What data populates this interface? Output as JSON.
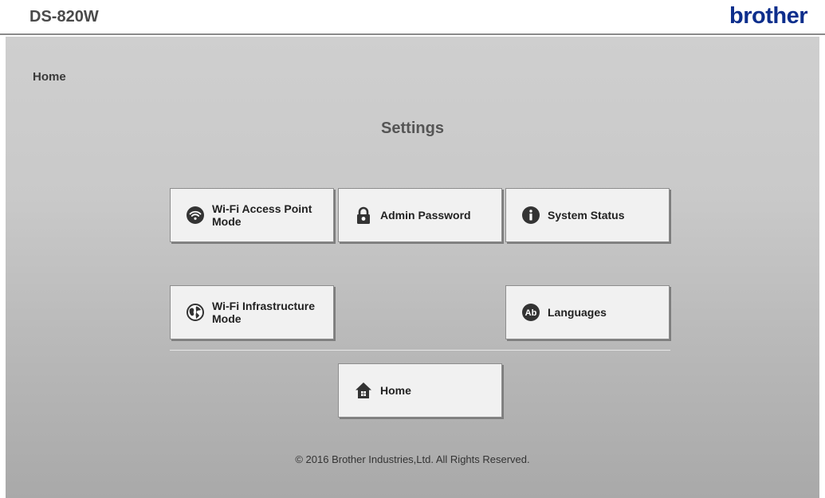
{
  "header": {
    "model": "DS-820W",
    "brand": "brother"
  },
  "breadcrumb": "Home",
  "page_title": "Settings",
  "buttons": {
    "wifi_ap": {
      "line1": "Wi-Fi Access Point",
      "line2": "Mode",
      "icon": "wifi-icon"
    },
    "admin_password": {
      "label": "Admin Password",
      "icon": "lock-icon"
    },
    "system_status": {
      "label": "System Status",
      "icon": "info-icon"
    },
    "wifi_infra": {
      "line1": "Wi-Fi Infrastructure",
      "line2": "Mode",
      "icon": "globe-icon"
    },
    "languages": {
      "label": "Languages",
      "icon": "languages-icon",
      "icon_text": "Ab"
    },
    "home": {
      "label": "Home",
      "icon": "home-icon"
    }
  },
  "footer": "© 2016 Brother Industries,Ltd. All Rights Reserved.",
  "colors": {
    "brand": "#0d2e8c",
    "icon": "#333333",
    "button_bg": "#f1f1f1"
  }
}
